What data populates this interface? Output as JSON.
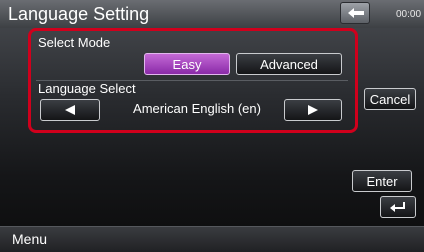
{
  "header": {
    "title": "Language Setting",
    "clock": "00:00"
  },
  "select_mode": {
    "label": "Select Mode",
    "options": [
      {
        "label": "Easy",
        "selected": true
      },
      {
        "label": "Advanced",
        "selected": false
      }
    ]
  },
  "language_select": {
    "label": "Language Select",
    "value": "American English (en)"
  },
  "side": {
    "cancel_label": "Cancel",
    "enter_label": "Enter"
  },
  "footer": {
    "menu_label": "Menu"
  },
  "colors": {
    "highlight": "#d0001c",
    "selected_button": "#a847c2"
  },
  "icons": {
    "back": "back-arrow-icon",
    "prev": "left-triangle-icon",
    "next": "right-triangle-icon",
    "return": "return-arrow-icon"
  }
}
